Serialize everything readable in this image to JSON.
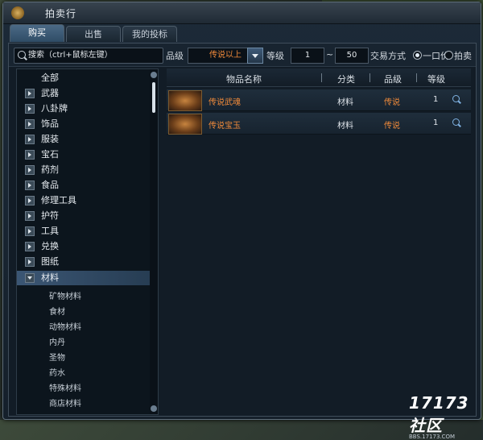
{
  "window": {
    "title": "拍卖行"
  },
  "tabs": [
    {
      "label": "购买",
      "active": true
    },
    {
      "label": "出售",
      "active": false
    },
    {
      "label": "我的投标",
      "active": false
    }
  ],
  "filters": {
    "search_placeholder": "搜索（ctrl+鼠标左键）",
    "grade_label": "品级",
    "grade_value": "传说以上",
    "level_label": "等级",
    "level_min": "1",
    "level_sep": "~",
    "level_max": "50",
    "trade_label": "交易方式",
    "trade_options": [
      "一口价",
      "拍卖"
    ]
  },
  "categories": [
    {
      "label": "全部",
      "expandable": false
    },
    {
      "label": "武器",
      "expandable": true
    },
    {
      "label": "八卦牌",
      "expandable": true
    },
    {
      "label": "饰品",
      "expandable": true
    },
    {
      "label": "服装",
      "expandable": true
    },
    {
      "label": "宝石",
      "expandable": true
    },
    {
      "label": "药剂",
      "expandable": true
    },
    {
      "label": "食品",
      "expandable": true
    },
    {
      "label": "修理工具",
      "expandable": true
    },
    {
      "label": "护符",
      "expandable": true
    },
    {
      "label": "工具",
      "expandable": true
    },
    {
      "label": "兑换",
      "expandable": true
    },
    {
      "label": "图纸",
      "expandable": true
    },
    {
      "label": "材料",
      "expandable": true,
      "open": true,
      "selected": true
    }
  ],
  "subcategories": [
    "矿物材料",
    "食材",
    "动物材料",
    "内丹",
    "圣物",
    "药水",
    "特殊材料",
    "商店材料"
  ],
  "table": {
    "headers": {
      "name": "物品名称",
      "category": "分类",
      "grade": "品级",
      "level": "等级"
    },
    "rows": [
      {
        "name": "传说武魂",
        "category": "材料",
        "grade": "传说",
        "level": "1"
      },
      {
        "name": "传说宝玉",
        "category": "材料",
        "grade": "传说",
        "level": "1"
      }
    ]
  },
  "watermark": {
    "logo": "17173社区",
    "url": "BBS.17173.COM"
  },
  "colors": {
    "legendary": "#f08a3a",
    "accent": "#3b5674"
  }
}
